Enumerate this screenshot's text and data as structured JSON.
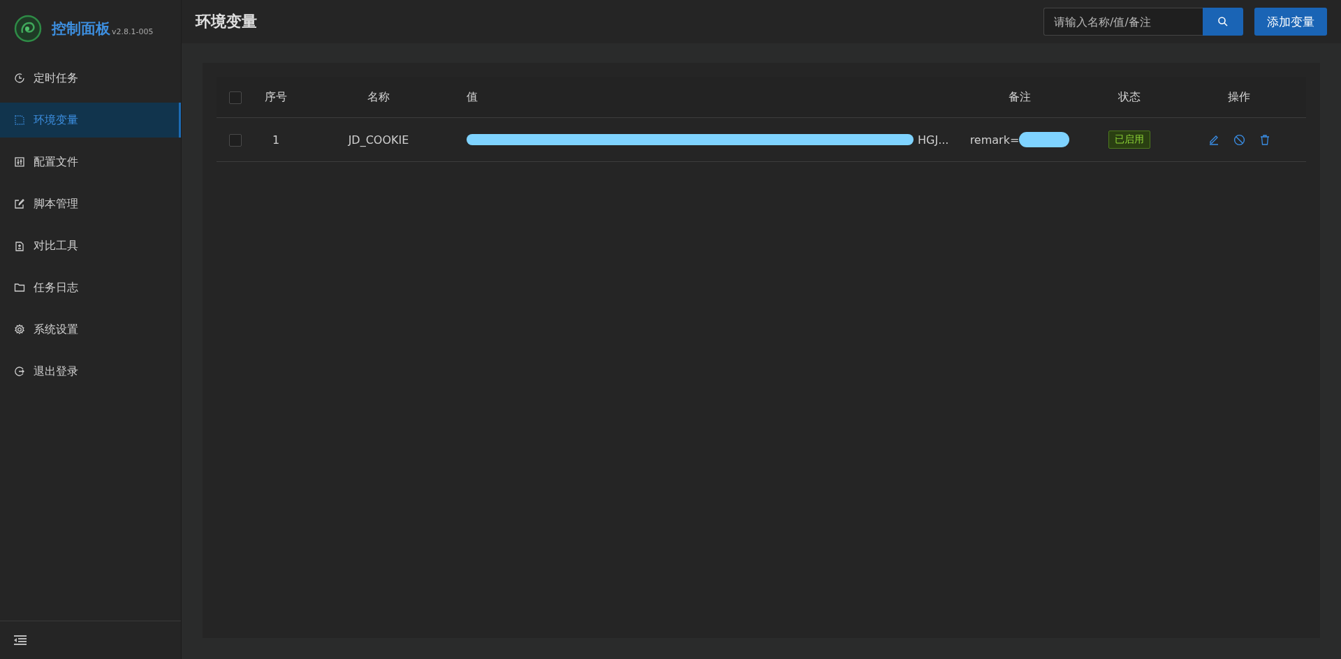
{
  "sidebar": {
    "title": "控制面板",
    "version": "v2.8.1-005",
    "items": [
      {
        "label": "定时任务",
        "selected": false
      },
      {
        "label": "环境变量",
        "selected": true
      },
      {
        "label": "配置文件",
        "selected": false
      },
      {
        "label": "脚本管理",
        "selected": false
      },
      {
        "label": "对比工具",
        "selected": false
      },
      {
        "label": "任务日志",
        "selected": false
      },
      {
        "label": "系统设置",
        "selected": false
      },
      {
        "label": "退出登录",
        "selected": false
      }
    ]
  },
  "header": {
    "title": "环境变量",
    "search": {
      "placeholder": "请输入名称/值/备注"
    },
    "add_button": "添加变量"
  },
  "table": {
    "select_all_checked": false,
    "columns": [
      "序号",
      "名称",
      "值",
      "备注",
      "状态",
      "操作"
    ],
    "rows": [
      {
        "checked": false,
        "index": "1",
        "name": "JD_COOKIE",
        "value": "HGJ...",
        "remark": "remark=",
        "status": "已启用",
        "enabled": true
      }
    ]
  }
}
